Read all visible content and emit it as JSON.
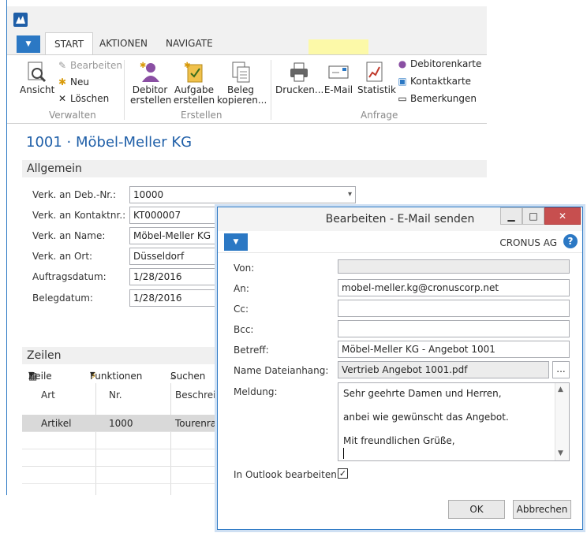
{
  "ribbon": {
    "tabs": [
      "START",
      "AKTIONEN",
      "NAVIGATE"
    ],
    "verwalten": {
      "ansicht": "Ansicht",
      "bearbeiten": "Bearbeiten",
      "neu": "Neu",
      "loeschen": "Löschen",
      "group": "Verwalten"
    },
    "erstellen": {
      "debitor_1": "Debitor",
      "debitor_2": "erstellen",
      "aufgabe_1": "Aufgabe",
      "aufgabe_2": "erstellen",
      "beleg_1": "Beleg",
      "beleg_2": "kopieren...",
      "group": "Erstellen"
    },
    "anfrage": {
      "drucken": "Drucken...",
      "email": "E-Mail",
      "statistik": "Statistik",
      "debitorenkarte": "Debitorenkarte",
      "kontaktkarte": "Kontaktkarte",
      "bemerkungen": "Bemerkungen",
      "group": "Anfrage"
    }
  },
  "page": {
    "title": "1001 · Möbel-Meller KG",
    "general_tab": "Allgemein",
    "fields": [
      {
        "label": "Verk. an Deb.-Nr.:",
        "value": "10000"
      },
      {
        "label": "Verk. an Kontaktnr.:",
        "value": "KT000007"
      },
      {
        "label": "Verk. an Name:",
        "value": "Möbel-Meller KG"
      },
      {
        "label": "Verk. an Ort:",
        "value": "Düsseldorf"
      },
      {
        "label": "Auftragsdatum:",
        "value": "1/28/2016"
      },
      {
        "label": "Belegdatum:",
        "value": "1/28/2016"
      }
    ]
  },
  "lines": {
    "title": "Zeilen",
    "toolbar": {
      "zeile": "Zeile",
      "funktionen": "Funktionen",
      "suchen": "Suchen"
    },
    "columns": [
      "Art",
      "Nr.",
      "Beschreib"
    ],
    "rows": [
      {
        "art": "Artikel",
        "nr": "1000",
        "beschreibung": "Tourenrad"
      }
    ]
  },
  "dialog": {
    "title": "Bearbeiten - E-Mail senden",
    "company": "CRONUS AG",
    "help": "?",
    "fields": {
      "von": {
        "label": "Von:",
        "value": ""
      },
      "an": {
        "label": "An:",
        "value": "mobel-meller.kg@cronuscorp.net"
      },
      "cc": {
        "label": "Cc:",
        "value": ""
      },
      "bcc": {
        "label": "Bcc:",
        "value": ""
      },
      "betreff": {
        "label": "Betreff:",
        "value": "Möbel-Meller KG - Angebot 1001"
      },
      "anhang": {
        "label": "Name Dateianhang:",
        "value": "Vertrieb Angebot 1001.pdf",
        "button": "..."
      },
      "meldung": {
        "label": "Meldung:",
        "lines": [
          "Sehr geehrte Damen und Herren,",
          "anbei wie gewünscht das Angebot.",
          "Mit freundlichen Grüße,"
        ]
      },
      "outlook": {
        "label": "In Outlook bearbeiten:",
        "checked": true
      }
    },
    "ok": "OK",
    "cancel": "Abbrechen"
  }
}
